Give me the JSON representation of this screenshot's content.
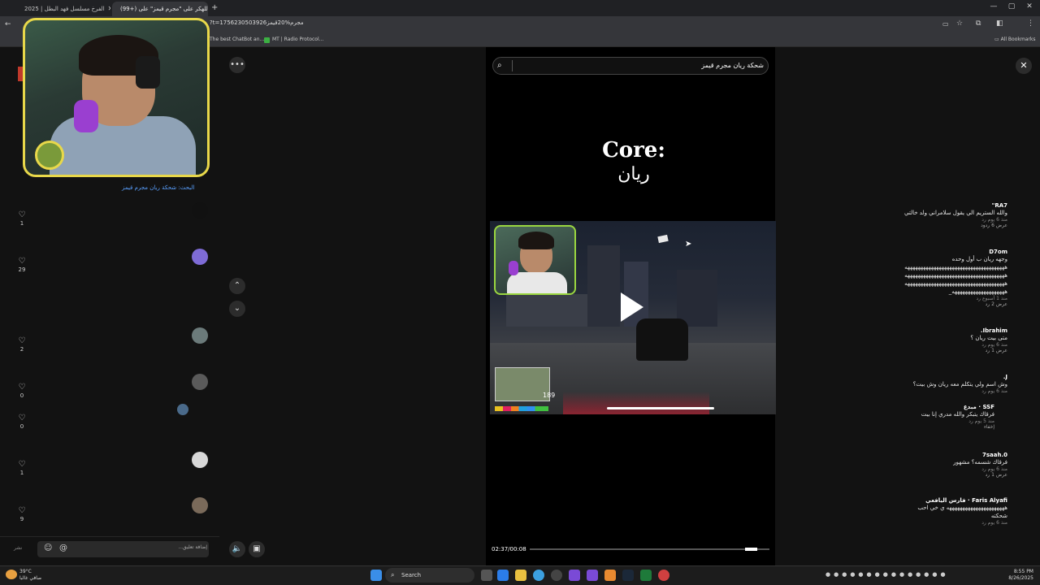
{
  "browser": {
    "tabs": [
      {
        "label": "2025 | الفرخ مسلسل فهد البطل",
        "active": false
      },
      {
        "label": "(99+) اللهكر على \"مجرم قيمز\" على...",
        "active": true
      }
    ],
    "url": "?t=1756230503926مجرم%20قيمز",
    "bookmarks": [
      "The best ChatBot an...",
      "MT | Radio Protocol..."
    ],
    "all_bookmarks": "All Bookmarks"
  },
  "comments_panel": {
    "search_note": "البحث: شحكة ريان مجرم قيمز",
    "comments": [
      {
        "user": "RA7\"",
        "text": "والله الستريم الي يقول سلامراني ولد خالتي",
        "meta": "منذ 6 يوم   رد",
        "replies": "عرض 6 ردود",
        "likes": "1"
      },
      {
        "user": "D7om",
        "text": "وجهه ريان ب أول وحده",
        "extra": [
          "ههههههههههههههههههههههههههههههههههههههه",
          "ههههههههههههههههههههههههههههههههههههههه",
          "ههههههههههههههههههههههههههههههههههههههه",
          "ههههههههههههههههههههه_"
        ],
        "meta": "منذ 1 أسبوع   رد",
        "replies": "عرض 2 رد",
        "likes": "29"
      },
      {
        "user": "Ibrahim.",
        "text": "متى بيت ريان ؟",
        "meta": "منذ 6 يوم   رد",
        "replies": "عرض 1 رد",
        "likes": "2"
      },
      {
        "user": "J.",
        "text": "وش اسم ولي يتكلم معه ريان وش بيت؟",
        "meta": "منذ 6 يوم   رد",
        "replies": "",
        "likes": "0"
      },
      {
        "user": "SSF · مبدع",
        "text": "فرقاك يتبكر والله مدري إنا بيت",
        "meta": "منذ 5 يوم   رد",
        "replies": "إخفاء",
        "likes": "0"
      },
      {
        "user": "7saah.0",
        "text": "فرقاك شسمه؟ مشهور",
        "meta": "منذ 6 يوم   رد",
        "replies": "عرض 1 رد",
        "likes": "1"
      },
      {
        "user": "Faris Alyafi · فارس اليافعي",
        "text": "ههههههههههههههههههههههه ي خي احب",
        "extra": [
          "شحكته"
        ],
        "meta": "منذ 6 يوم   رد",
        "replies": "",
        "likes": "9"
      }
    ],
    "reply_placeholder": "إضافة تعليق...",
    "send_label": "نشر"
  },
  "video": {
    "search_value": "شحكة ريان مجرم قيمز",
    "title": "Core:",
    "subtitle": "ريان",
    "hud_number": "189",
    "timecode": "02:37/00:08",
    "progress": 0.95
  },
  "taskbar": {
    "search_label": "Search",
    "weather_temp": "39°C",
    "weather_desc": "صافي غالبا",
    "time": "8:55 PM",
    "date": "8/26/2025"
  }
}
